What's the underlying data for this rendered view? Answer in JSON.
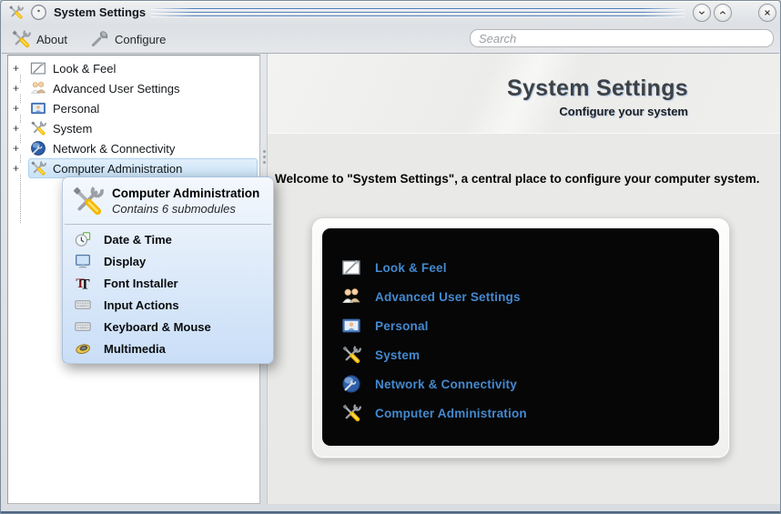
{
  "window": {
    "title": "System Settings"
  },
  "toolbar": {
    "about_label": "About",
    "configure_label": "Configure",
    "search_placeholder": "Search"
  },
  "tree": {
    "expander": "+",
    "items": [
      {
        "label": "Look & Feel"
      },
      {
        "label": "Advanced User Settings"
      },
      {
        "label": "Personal"
      },
      {
        "label": "System"
      },
      {
        "label": "Network & Connectivity"
      },
      {
        "label": "Computer Administration"
      }
    ]
  },
  "popup": {
    "title": "Computer Administration",
    "subtitle": "Contains 6 submodules",
    "items": [
      {
        "label": "Date & Time"
      },
      {
        "label": "Display"
      },
      {
        "label": "Font Installer"
      },
      {
        "label": "Input Actions"
      },
      {
        "label": "Keyboard & Mouse"
      },
      {
        "label": "Multimedia"
      }
    ]
  },
  "content": {
    "title": "System Settings",
    "subtitle": "Configure your system",
    "welcome": "Welcome to \"System Settings\", a central place to configure your computer system.",
    "items": [
      {
        "label": "Look & Feel"
      },
      {
        "label": "Advanced User Settings"
      },
      {
        "label": "Personal"
      },
      {
        "label": "System"
      },
      {
        "label": "Network & Connectivity"
      },
      {
        "label": "Computer Administration"
      }
    ]
  },
  "colors": {
    "overview_link_blue": "#4489cf",
    "tree_selection_blue": "#cde3f7",
    "popup_gradient_top": "#f4f8fd",
    "popup_gradient_bottom": "#c9def7",
    "titlebar_groove_blue": "#4678b9",
    "overview_bg": "#060606"
  }
}
